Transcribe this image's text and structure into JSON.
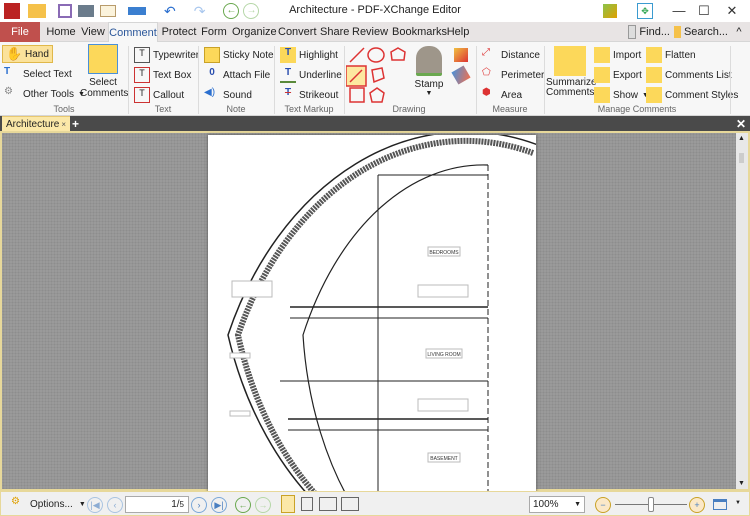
{
  "window": {
    "title": "Architecture - PDF-XChange Editor"
  },
  "quick_access": {
    "icons": [
      "app-logo-icon",
      "open-folder-icon",
      "save-icon",
      "print-icon",
      "email-icon",
      "scan-icon",
      "undo-icon",
      "redo-icon",
      "back-icon",
      "forward-icon"
    ]
  },
  "menu": {
    "tabs": [
      "File",
      "Home",
      "View",
      "Comment",
      "Protect",
      "Form",
      "Organize",
      "Convert",
      "Share",
      "Review",
      "Bookmarks",
      "Help"
    ],
    "active": "Comment",
    "find": "Find...",
    "search": "Search..."
  },
  "ribbon": {
    "tools": {
      "hand": "Hand",
      "select_text": "Select Text",
      "other_tools": "Other Tools",
      "select_comments": "Select Comments",
      "label": "Tools"
    },
    "text": {
      "typewriter": "Typewriter",
      "text_box": "Text Box",
      "callout": "Callout",
      "label": "Text"
    },
    "note": {
      "sticky_note": "Sticky Note",
      "attach_file": "Attach File",
      "sound": "Sound",
      "label": "Note"
    },
    "markup": {
      "highlight": "Highlight",
      "underline": "Underline",
      "strikeout": "Strikeout",
      "label": "Text Markup"
    },
    "drawing": {
      "stamp": "Stamp",
      "label": "Drawing"
    },
    "measure": {
      "distance": "Distance",
      "perimeter": "Perimeter",
      "area": "Area",
      "label": "Measure"
    },
    "manage": {
      "summarize": "Summarize Comments",
      "import": "Import",
      "export": "Export",
      "show": "Show",
      "flatten": "Flatten",
      "comments_list": "Comments List",
      "comment_styles": "Comment Styles",
      "label": "Manage Comments"
    }
  },
  "document": {
    "tab": "Architecture",
    "rooms": [
      "BEDROOMS",
      "LIVING ROOM",
      "BASEMENT"
    ]
  },
  "status": {
    "options": "Options...",
    "page_current": "1",
    "page_total": "5",
    "zoom": "100%",
    "zoom_level": 0.5
  }
}
